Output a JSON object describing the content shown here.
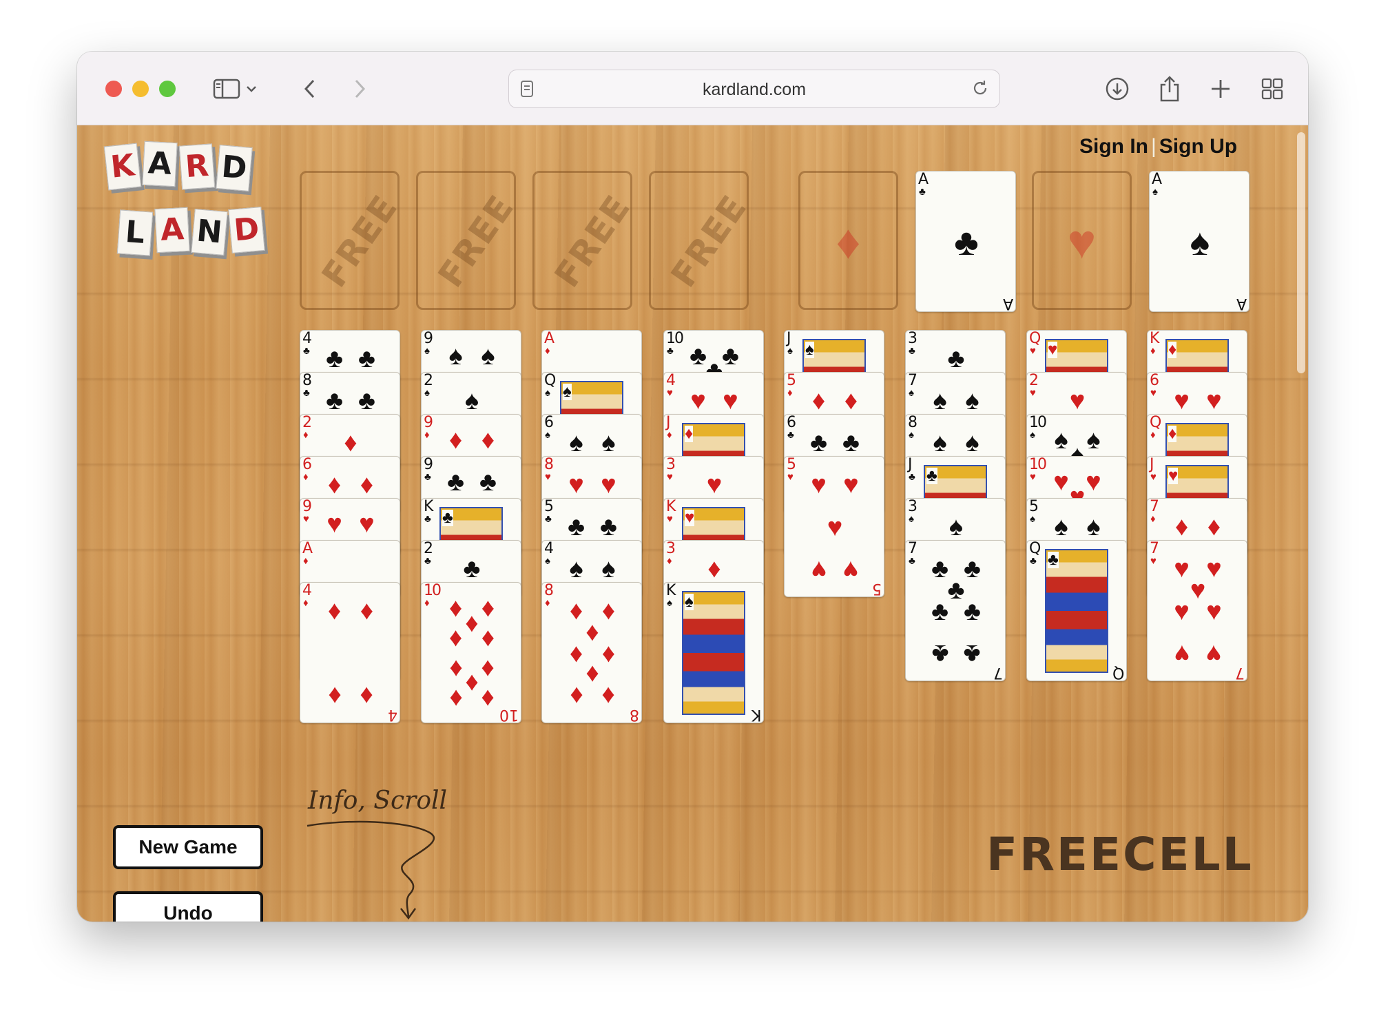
{
  "browser": {
    "url": "kardland.com",
    "traffic_lights": [
      "#ee5a52",
      "#f5bd2f",
      "#5fc83f"
    ]
  },
  "header": {
    "sign_in": "Sign In",
    "separator": "|",
    "sign_up": "Sign Up"
  },
  "logo": {
    "row1": [
      "K",
      "A",
      "R",
      "D"
    ],
    "row2": [
      "L",
      "A",
      "N",
      "D"
    ],
    "colors": [
      "#c0262b",
      "#1a1a1a"
    ]
  },
  "freecells": [
    "FREE",
    "FREE",
    "FREE",
    "FREE"
  ],
  "foundations": [
    {
      "suit": "♦",
      "top_card": null
    },
    {
      "suit": "♣",
      "top_card": "A♣"
    },
    {
      "suit": "♥",
      "top_card": null
    },
    {
      "suit": "♠",
      "top_card": "A♠"
    }
  ],
  "tableau": [
    [
      "4♣",
      "8♣",
      "2♦",
      "6♦",
      "9♥",
      "A♦",
      "4♦"
    ],
    [
      "9♠",
      "2♠",
      "9♦",
      "9♣",
      "K♣",
      "2♣",
      "10♦"
    ],
    [
      "A♦",
      "Q♠",
      "6♠",
      "8♥",
      "5♣",
      "4♠",
      "8♦"
    ],
    [
      "10♣",
      "4♥",
      "J♦",
      "3♥",
      "K♥",
      "3♦",
      "K♠"
    ],
    [
      "J♠",
      "5♦",
      "6♣",
      "5♥"
    ],
    [
      "3♣",
      "7♠",
      "8♠",
      "J♣",
      "3♠",
      "7♣"
    ],
    [
      "Q♥",
      "2♥",
      "10♠",
      "10♥",
      "5♠",
      "Q♣"
    ],
    [
      "K♦",
      "6♥",
      "Q♦",
      "J♥",
      "7♦",
      "7♥"
    ]
  ],
  "controls": {
    "new_game": "New Game",
    "undo": "Undo"
  },
  "info_label": "Info, Scroll",
  "game_title": "FREECELL",
  "colors": {
    "red_suit": "#d21f1f",
    "black_suit": "#111111"
  }
}
